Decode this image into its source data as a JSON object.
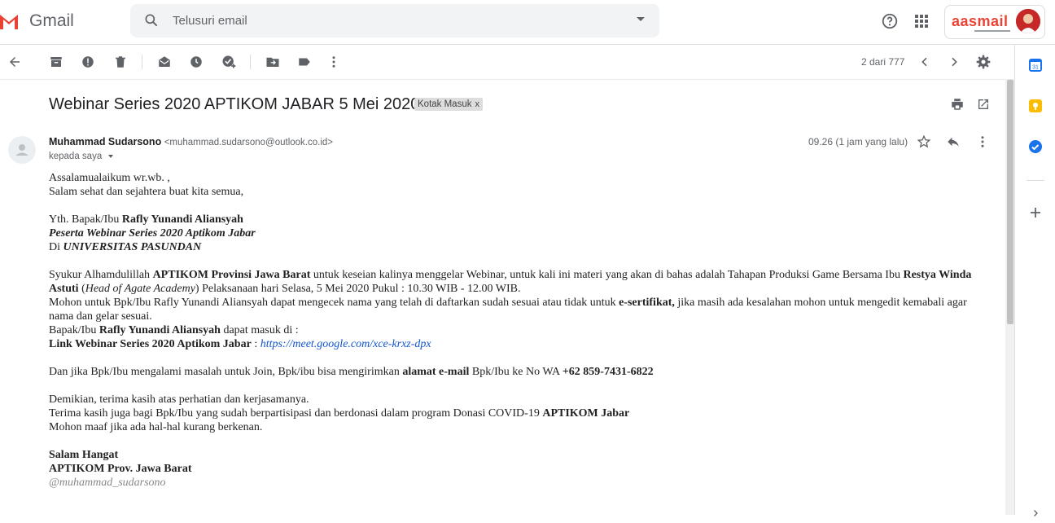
{
  "app": {
    "name": "Gmail"
  },
  "search": {
    "placeholder": "Telusuri email"
  },
  "brand": {
    "text": "asmail"
  },
  "toolbar": {
    "pager": "2 dari 777"
  },
  "email": {
    "subject": "Webinar Series 2020 APTIKOM JABAR 5 Mei 2020",
    "label": "Kotak Masuk",
    "label_close": "x",
    "sender_name": "Muhammad Sudarsono",
    "sender_email": "<muhammad.sudarsono@outlook.co.id>",
    "to": "kepada saya",
    "time": "09.26 (1 jam yang lalu)",
    "body": {
      "l1": "Assalamualaikum wr.wb. ,",
      "l2": "Salam sehat dan sejahtera buat kita semua,",
      "l3_pre": "Yth. Bapak/Ibu ",
      "l3_name": "Rafly Yunandi Aliansyah",
      "l4": "Peserta Webinar Series 2020 Aptikom Jabar",
      "l5_pre": "Di ",
      "l5_uni": "UNIVERSITAS PASUNDAN",
      "p1_a": "Syukur Alhamdulillah ",
      "p1_b": "APTIKOM Provinsi Jawa Barat",
      "p1_c": " untuk keseian kalinya menggelar Webinar, untuk kali ini materi yang akan di bahas adalah Tahapan Produksi Game Bersama Ibu ",
      "p1_d": "Restya Winda Astuti",
      "p1_e": " (",
      "p1_f": "Head of Agate Academy",
      "p1_g": ") Pelaksanaan hari Selasa, 5 Mei 2020 Pukul : 10.30 WIB - 12.00 WIB.",
      "p2_a": "Mohon untuk Bpk/Ibu Rafly Yunandi Aliansyah dapat mengecek nama yang telah di daftarkan sudah sesuai atau tidak untuk ",
      "p2_b": "e-sertifikat,",
      "p2_c": " jika masih ada kesalahan mohon untuk mengedit kemabali agar nama dan gelar sesuai.",
      "p3_a": "Bapak/Ibu ",
      "p3_b": "Rafly Yunandi Aliansyah",
      "p3_c": " dapat masuk di :",
      "p4_a": "Link Webinar Series 2020 Aptikom Jabar",
      "p4_b": " : ",
      "p4_link": "https://meet.google.com/xce-krxz-dpx",
      "p5_a": "Dan jika Bpk/Ibu mengalami masalah untuk Join, Bpk/ibu bisa mengirimkan ",
      "p5_b": "alamat e-mail",
      "p5_c": " Bpk/Ibu ke No WA ",
      "p5_d": "+62 859-7431-6822",
      "p6": "Demikian, terima kasih atas perhatian dan kerjasamanya.",
      "p7_a": "Terima kasih juga bagi Bpk/Ibu yang sudah berpartisipasi dan berdonasi dalam program Donasi COVID-19 ",
      "p7_b": "APTIKOM Jabar",
      "p8": "Mohon maaf jika ada hal-hal kurang berkenan.",
      "sig1": "Salam Hangat",
      "sig2": "APTIKOM Prov. Jawa Barat",
      "sig3": "@muhammad_sudarsono"
    }
  },
  "colors": {
    "gmail_red": "#ea4335",
    "link": "#1155cc",
    "icon": "#5f6368",
    "calendar": "#1a73e8",
    "keep": "#fbbc04",
    "tasks": "#1a73e8"
  },
  "icons": [
    "gmail-logo-icon",
    "search-icon",
    "dropdown-caret-icon",
    "help-icon",
    "apps-grid-icon",
    "back-arrow-icon",
    "archive-icon",
    "report-spam-icon",
    "delete-icon",
    "mark-unread-icon",
    "snooze-icon",
    "add-task-icon",
    "move-to-icon",
    "label-icon",
    "more-vert-icon",
    "chevron-left-icon",
    "chevron-right-icon",
    "settings-gear-icon",
    "print-icon",
    "open-new-window-icon",
    "person-icon",
    "star-icon",
    "reply-icon",
    "calendar-icon",
    "keep-icon",
    "tasks-icon",
    "plus-icon"
  ]
}
